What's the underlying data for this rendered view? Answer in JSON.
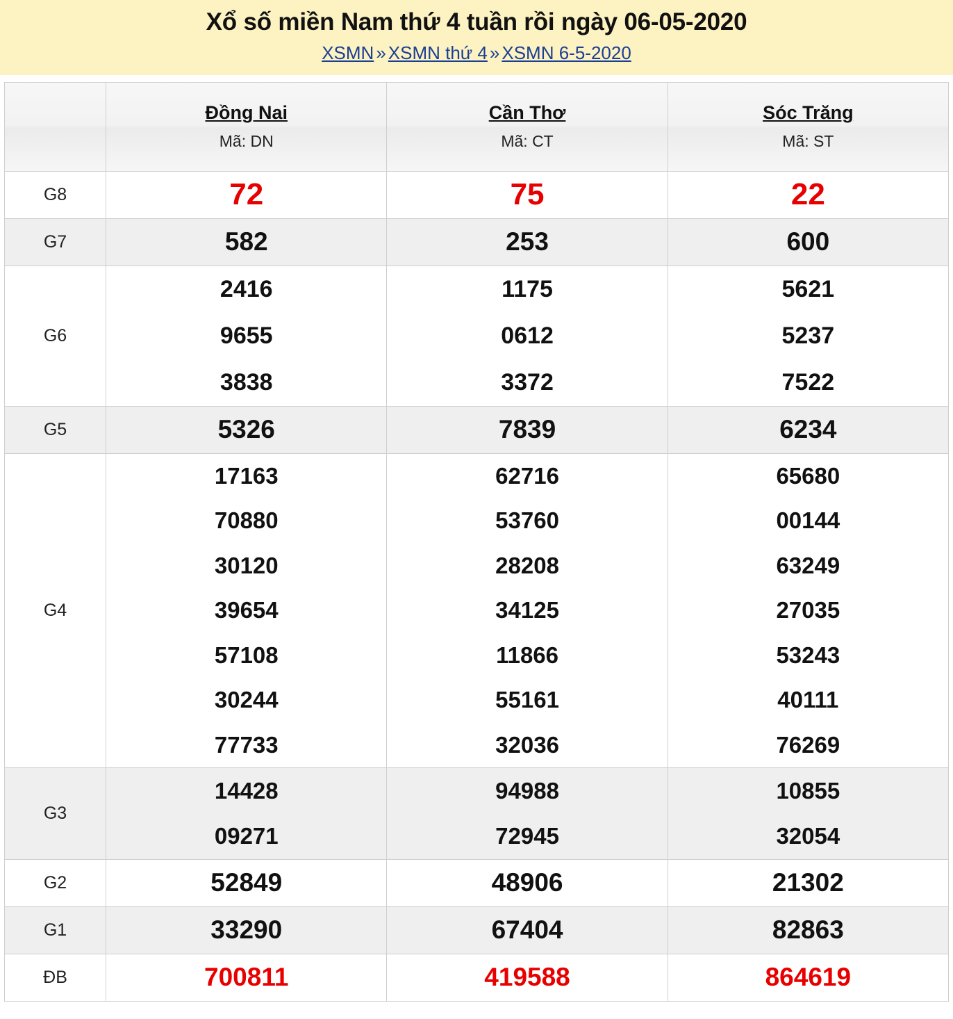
{
  "header": {
    "title": "Xổ số miền Nam thứ 4 tuần rồi ngày 06-05-2020",
    "breadcrumb": {
      "items": [
        {
          "label": "XSMN"
        },
        {
          "label": "XSMN thứ 4"
        },
        {
          "label": "XSMN 6-5-2020"
        }
      ],
      "separator": "»"
    },
    "bg_color": "#fdf2c2",
    "link_color": "#1b3f94"
  },
  "table": {
    "corner_label": "",
    "columns": [
      {
        "name": "Đồng Nai",
        "code": "Mã: DN"
      },
      {
        "name": "Cần Thơ",
        "code": "Mã: CT"
      },
      {
        "name": "Sóc Trăng",
        "code": "Mã: ST"
      }
    ],
    "accent_red": "#e80000",
    "rows": [
      {
        "prize": "G8",
        "values": [
          [
            "72"
          ],
          [
            "75"
          ],
          [
            "22"
          ]
        ]
      },
      {
        "prize": "G7",
        "values": [
          [
            "582"
          ],
          [
            "253"
          ],
          [
            "600"
          ]
        ]
      },
      {
        "prize": "G6",
        "values": [
          [
            "2416",
            "9655",
            "3838"
          ],
          [
            "1175",
            "0612",
            "3372"
          ],
          [
            "5621",
            "5237",
            "7522"
          ]
        ]
      },
      {
        "prize": "G5",
        "values": [
          [
            "5326"
          ],
          [
            "7839"
          ],
          [
            "6234"
          ]
        ]
      },
      {
        "prize": "G4",
        "values": [
          [
            "17163",
            "70880",
            "30120",
            "39654",
            "57108",
            "30244",
            "77733"
          ],
          [
            "62716",
            "53760",
            "28208",
            "34125",
            "11866",
            "55161",
            "32036"
          ],
          [
            "65680",
            "00144",
            "63249",
            "27035",
            "53243",
            "40111",
            "76269"
          ]
        ]
      },
      {
        "prize": "G3",
        "values": [
          [
            "14428",
            "09271"
          ],
          [
            "94988",
            "72945"
          ],
          [
            "10855",
            "32054"
          ]
        ]
      },
      {
        "prize": "G2",
        "values": [
          [
            "52849"
          ],
          [
            "48906"
          ],
          [
            "21302"
          ]
        ]
      },
      {
        "prize": "G1",
        "values": [
          [
            "33290"
          ],
          [
            "67404"
          ],
          [
            "82863"
          ]
        ]
      },
      {
        "prize": "ĐB",
        "values": [
          [
            "700811"
          ],
          [
            "419588"
          ],
          [
            "864619"
          ]
        ]
      }
    ]
  }
}
